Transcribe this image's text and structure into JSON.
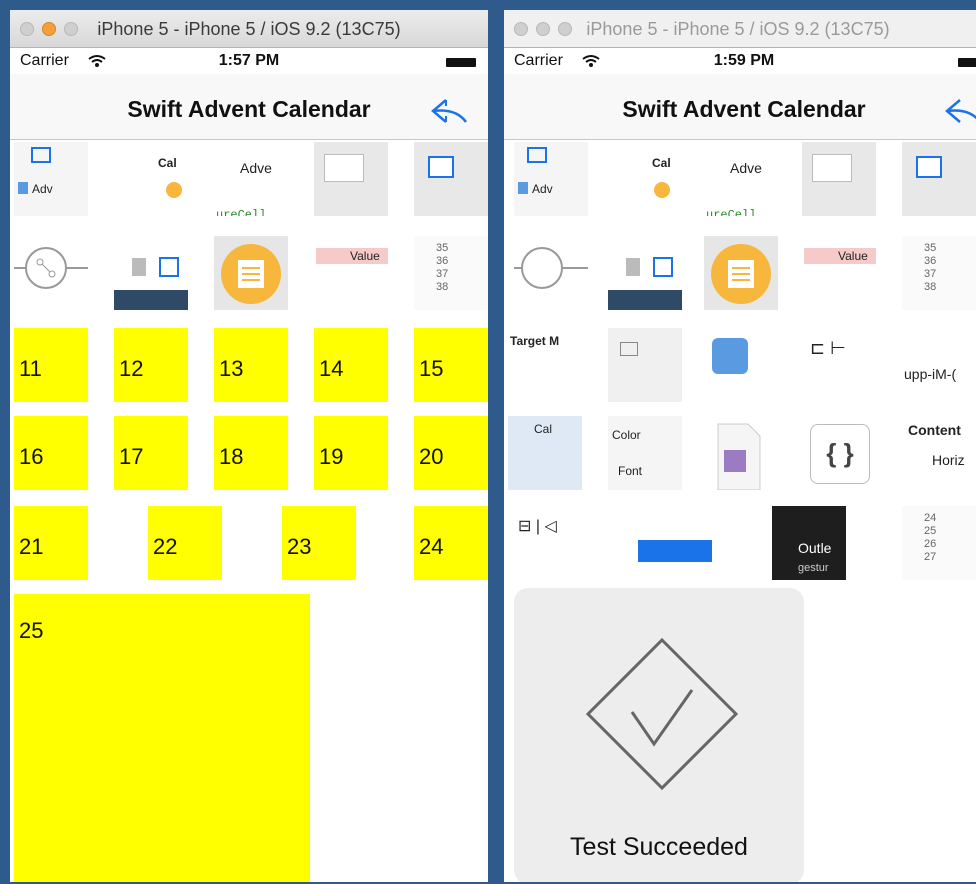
{
  "window_title": "iPhone 5 - iPhone 5 / iOS 9.2 (13C75)",
  "left": {
    "carrier": "Carrier",
    "time": "1:57 PM",
    "nav_title": "Swift Advent Calendar",
    "days": [
      "11",
      "12",
      "13",
      "14",
      "15",
      "16",
      "17",
      "18",
      "19",
      "20",
      "21",
      "22",
      "23",
      "24",
      "25"
    ]
  },
  "right": {
    "carrier": "Carrier",
    "time": "1:59 PM",
    "nav_title": "Swift Advent Calendar",
    "hud_message": "Test Succeeded"
  },
  "thumb_labels": {
    "cal": "Cal",
    "adve": "Adve",
    "adv": "Adv",
    "value": "Value",
    "target": "Target M",
    "color": "Color",
    "font": "Font",
    "content": "Content",
    "horiz": "Horiz",
    "upp": "upp-iM-(",
    "outlet": "Outle",
    "gesture": "gestur",
    "cell": "ureCell"
  },
  "colors": {
    "day_cell": "#ffff00",
    "nav_tint": "#1a73e8",
    "window_frame": "#2f5a8c"
  },
  "icons": [
    "wifi-icon",
    "battery-icon",
    "reply-icon",
    "checkmark-diamond-icon",
    "notes-icon",
    "trash-icon",
    "braces-icon"
  ]
}
